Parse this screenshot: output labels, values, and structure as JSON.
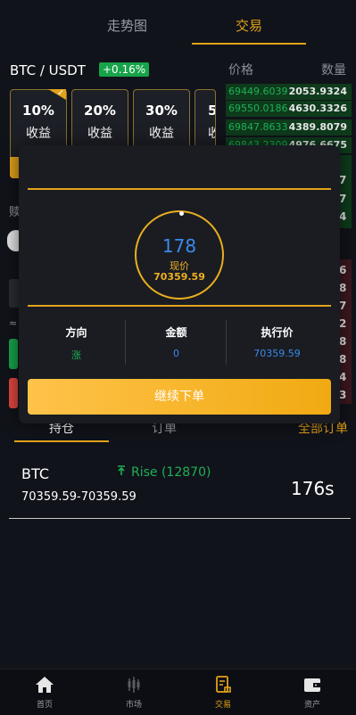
{
  "top_tabs": [
    {
      "label": "走势图",
      "active": false
    },
    {
      "label": "交易",
      "active": true
    }
  ],
  "pair": {
    "symbol": "BTC / USDT",
    "change": "+0.16%"
  },
  "order_book": {
    "price_header": "价格",
    "qty_header": "数量",
    "asks": [
      {
        "price": "69449.6039",
        "qty": "2053.9324"
      },
      {
        "price": "69550.0186",
        "qty": "4630.3326"
      },
      {
        "price": "69847.8633",
        "qty": "4389.8079"
      },
      {
        "price": "69843.2309",
        "qty": "4976.6675"
      }
    ],
    "edge_digits_top": [
      "7",
      "7",
      "4"
    ],
    "edge_digits_bottom": [
      "6",
      "8",
      "7",
      "2",
      "8",
      "8",
      "4",
      "3"
    ]
  },
  "percent_cards": [
    {
      "pct": "10%",
      "label": "收益"
    },
    {
      "pct": "20%",
      "label": "收益"
    },
    {
      "pct": "30%",
      "label": "收益"
    },
    {
      "pct": "5",
      "label": "收"
    }
  ],
  "behind_label": "赎",
  "approx_sign": "≈",
  "modal": {
    "countdown": "178",
    "now_label": "现价",
    "now_price": "70359.59",
    "columns": [
      {
        "header": "方向",
        "value": "涨",
        "color": "#1fb056"
      },
      {
        "header": "金额",
        "value": "0",
        "color": "#3a8bea"
      },
      {
        "header": "执行价",
        "value": "70359.59",
        "color": "#3a8bea"
      }
    ],
    "continue_label": "继续下单"
  },
  "position_tabs": {
    "holdings": "持仓",
    "orders": "订单",
    "all_orders": "全部订单"
  },
  "position": {
    "symbol": "BTC",
    "direction": "Rise (12870)",
    "range": "70359.59-70359.59",
    "timer": "176s"
  },
  "bottom_nav": [
    {
      "label": "首页",
      "icon": "home-icon",
      "active": false
    },
    {
      "label": "市场",
      "icon": "market-icon",
      "active": false
    },
    {
      "label": "交易",
      "icon": "trade-icon",
      "active": true
    },
    {
      "label": "资产",
      "icon": "wallet-icon",
      "active": false
    }
  ],
  "colors": {
    "accent": "#e2a21a",
    "up": "#1fb056",
    "down": "#e0473f",
    "blue": "#3a8bea"
  }
}
